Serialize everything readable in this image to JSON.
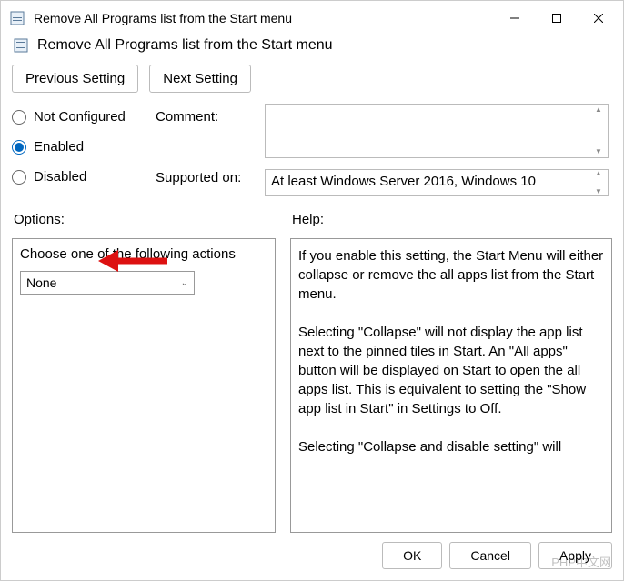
{
  "title": "Remove All Programs list from the Start menu",
  "header": "Remove All Programs list from the Start menu",
  "nav": {
    "prev": "Previous Setting",
    "next": "Next Setting"
  },
  "radios": {
    "not_configured": "Not Configured",
    "enabled": "Enabled",
    "disabled": "Disabled",
    "selected": "enabled"
  },
  "labels": {
    "comment": "Comment:",
    "supported": "Supported on:"
  },
  "comment_value": "",
  "supported_value": "At least Windows Server 2016, Windows 10",
  "panes": {
    "options_title": "Options:",
    "help_title": "Help:"
  },
  "options": {
    "label": "Choose one of the following actions",
    "combo_value": "None"
  },
  "help_text": "If you enable this setting, the Start Menu will either collapse or remove the all apps list from the Start menu.\n\nSelecting \"Collapse\" will not display the app list next to the pinned tiles in Start. An \"All apps\" button will be displayed on Start to open the all apps list. This is equivalent to setting the \"Show app list in Start\" in Settings to Off.\n\nSelecting \"Collapse and disable setting\" will",
  "footer": {
    "ok": "OK",
    "cancel": "Cancel",
    "apply": "Apply"
  },
  "watermark": "PHP中文网"
}
